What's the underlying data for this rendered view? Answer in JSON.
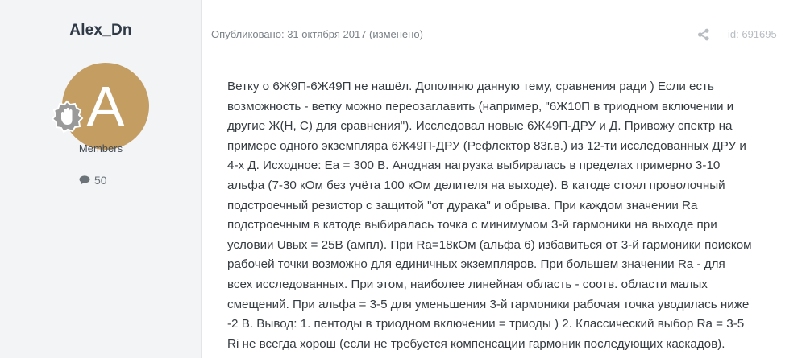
{
  "author": {
    "name": "Alex_Dn",
    "avatar_letter": "A",
    "avatar_color": "#c49d63",
    "rank_icon": "hand-badge-icon",
    "group": "Members",
    "post_count_icon": "comment-icon",
    "post_count": "50"
  },
  "post": {
    "meta": "Опубликовано: 31 октября 2017 (изменено)",
    "share_icon": "share-icon",
    "post_id": "id: 691695",
    "lines": [
      "Ветку о 6Ж9П-6Ж49П не нашёл. Дополняю данную тему, сравнения ради ) Если есть",
      "возможность - ветку можно переозаглавить (например, \"6Ж10П в триодном включении и",
      "другие Ж(Н, С) для сравнения\"). Исследовал новые 6Ж49П-ДРУ и Д. Привожу спектр на",
      "примере одного экземпляра 6Ж49П-ДРУ (Рефлектор 83г.в.) из 12-ти исследованных ДРУ и",
      "4-х Д. Исходное: Еа = 300 В. Анодная нагрузка выбиралась в пределах примерно 3-10",
      "альфа (7-30 кОм без учёта 100 кОм делителя на выходе). В катоде стоял проволочный",
      "подстроечный резистор с защитой \"от дурака\" и обрыва. При каждом значении Ra",
      "подстроечным в катоде выбиралась точка с минимумом 3-й гармоники на выходе при",
      "условии Uвых = 25В (ампл). При Ra=18кОм (альфа 6) избавиться от 3-й гармоники поиском",
      "рабочей точки возможно для единичных экземпляров. При большем значении Ra - для",
      "всех исследованных. При этом, наиболее линейная область - соотв. области малых",
      "смещений. При альфа = 3-5 для уменьшения 3-й гармоники рабочая точка уводилась ниже",
      "-2 В. Вывод: 1. пентоды в триодном включении = триоды ) 2. Классический выбор Ra = 3-5",
      "Ri не всегда хорош (если не требуется компенсации гармоник последующих каскадов)."
    ]
  }
}
